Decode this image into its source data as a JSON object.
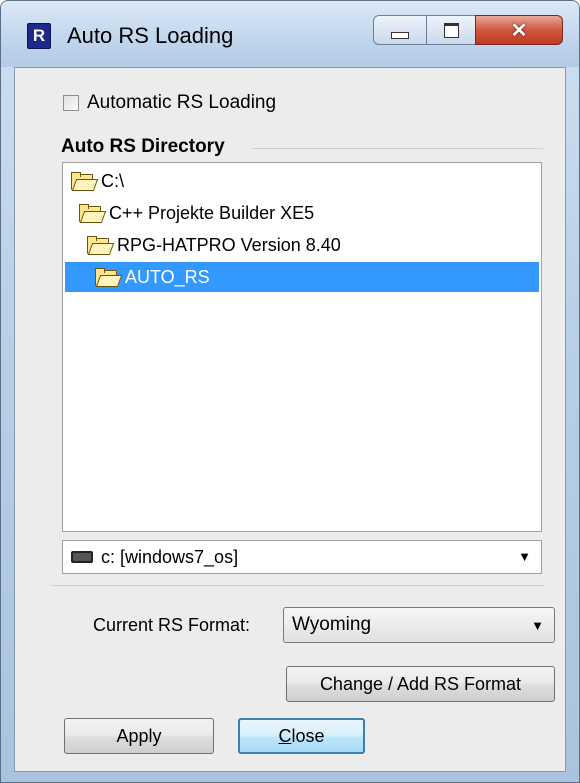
{
  "window": {
    "title": "Auto RS Loading",
    "icon_letter": "R",
    "controls": {
      "minimize": "minimize-icon",
      "maximize": "maximize-icon",
      "close": "close-icon"
    }
  },
  "auto_loading": {
    "label": "Automatic RS Loading",
    "checked": false
  },
  "directory": {
    "group_label": "Auto RS Directory",
    "tree": [
      {
        "label": "C:\\",
        "level": 0,
        "selected": false
      },
      {
        "label": "C++ Projekte Builder XE5",
        "level": 1,
        "selected": false
      },
      {
        "label": "RPG-HATPRO Version 8.40",
        "level": 2,
        "selected": false
      },
      {
        "label": "AUTO_RS",
        "level": 3,
        "selected": true
      }
    ],
    "drive": {
      "value": "c: [windows7_os]",
      "icon": "drive-icon"
    }
  },
  "format": {
    "label": "Current RS Format:",
    "value": "Wyoming",
    "change_button": "Change / Add RS Format"
  },
  "buttons": {
    "apply": "Apply",
    "close_prefix": "C",
    "close_rest": "lose"
  },
  "colors": {
    "selection": "#3399ff",
    "close_button": "#c23a20",
    "default_button_border": "#3c7fb1"
  }
}
